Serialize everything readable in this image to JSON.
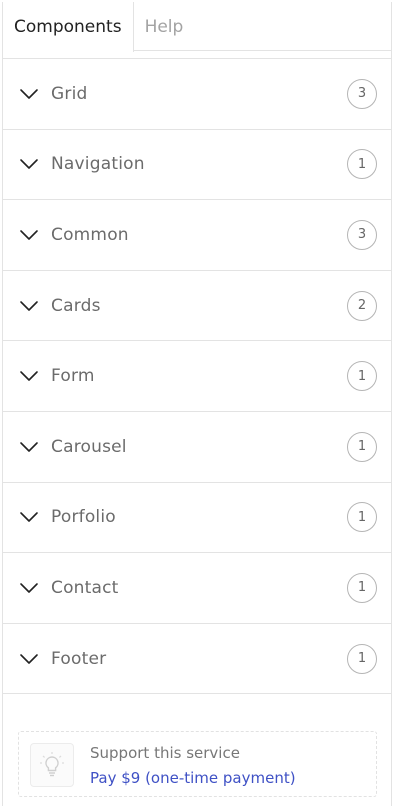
{
  "tabs": [
    {
      "label": "Components",
      "active": true
    },
    {
      "label": "Help",
      "active": false
    }
  ],
  "sections": [
    {
      "label": "Grid",
      "count": "3"
    },
    {
      "label": "Navigation",
      "count": "1"
    },
    {
      "label": "Common",
      "count": "3"
    },
    {
      "label": "Cards",
      "count": "2"
    },
    {
      "label": "Form",
      "count": "1"
    },
    {
      "label": "Carousel",
      "count": "1"
    },
    {
      "label": "Porfolio",
      "count": "1"
    },
    {
      "label": "Contact",
      "count": "1"
    },
    {
      "label": "Footer",
      "count": "1"
    }
  ],
  "support": {
    "icon": "lightbulb-icon",
    "title": "Support this service",
    "link": "Pay $9 (one-time payment)"
  },
  "colors": {
    "link": "#3f51c5",
    "border": "#e3e3e3",
    "text": "#6b6b6b"
  }
}
